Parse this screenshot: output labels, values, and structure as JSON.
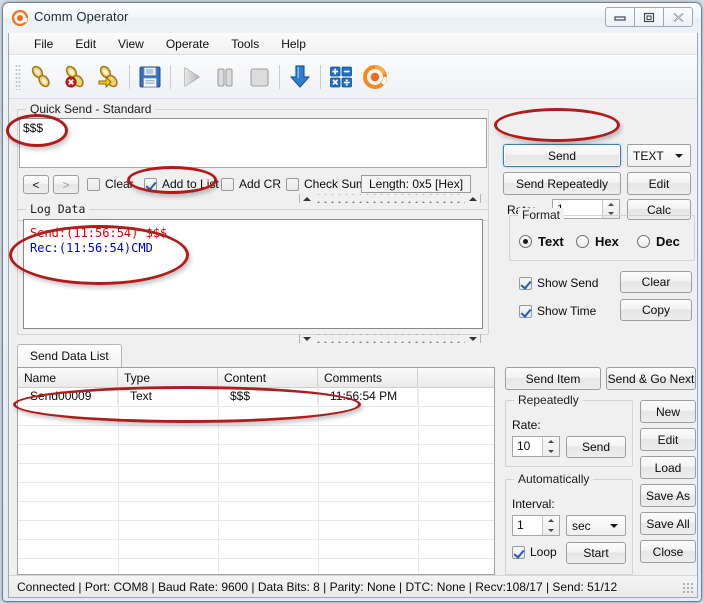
{
  "window": {
    "title": "Comm Operator",
    "app_icon": "comm-operator-logo-icon",
    "controls": {
      "minimize": "minimize-icon",
      "maximize": "maximize-icon",
      "close": "close-icon"
    }
  },
  "menubar": {
    "items": [
      "File",
      "Edit",
      "View",
      "Operate",
      "Tools",
      "Help"
    ]
  },
  "toolbar": {
    "items": [
      {
        "name": "connect-icon",
        "label": "Connect"
      },
      {
        "name": "disconnect-icon",
        "label": "Disconnect"
      },
      {
        "name": "reconnect-icon",
        "label": "Reconnect"
      },
      {
        "name": "save-icon",
        "label": "Save"
      },
      {
        "name": "play-icon",
        "label": "Start"
      },
      {
        "name": "pause-icon",
        "label": "Pause"
      },
      {
        "name": "stop-icon",
        "label": "Stop"
      },
      {
        "name": "download-arrow-icon",
        "label": "Receive"
      },
      {
        "name": "calculator-icon",
        "label": "Calculator"
      },
      {
        "name": "comm-operator-logo-icon",
        "label": "About"
      }
    ]
  },
  "quick_send": {
    "group_title": "Quick Send - Standard",
    "input_value": "$$$",
    "nav_prev": "<",
    "nav_next": ">",
    "checkboxes": [
      {
        "label": "Clear",
        "checked": false
      },
      {
        "label": "Add to List",
        "checked": true
      },
      {
        "label": "Add CR",
        "checked": false
      },
      {
        "label": "Check Sum",
        "checked": false
      }
    ],
    "length_label": "Length: 0x5 [Hex]",
    "send_button": "Send",
    "send_repeatedly_button": "Send Repeatedly",
    "format_combo": "TEXT",
    "edit_button": "Edit",
    "calc_button": "Calc",
    "rate_label": "Rate:",
    "rate_value": "1"
  },
  "log": {
    "group_title": "Log Data",
    "lines": [
      {
        "kind": "send",
        "text": "Send:(11:56:54) $$$"
      },
      {
        "kind": "rec",
        "text": "Rec:(11:56:54)CMD"
      }
    ]
  },
  "format_panel": {
    "group_title": "Format",
    "options": [
      {
        "label": "Text",
        "selected": true
      },
      {
        "label": "Hex",
        "selected": false
      },
      {
        "label": "Dec",
        "selected": false
      }
    ],
    "checkboxes": [
      {
        "label": "Show Send",
        "checked": true
      },
      {
        "label": "Show Time",
        "checked": true
      }
    ],
    "clear_button": "Clear",
    "copy_button": "Copy"
  },
  "send_data_list": {
    "tab_label": "Send Data List",
    "columns": [
      "Name",
      "Type",
      "Content",
      "Comments"
    ],
    "rows": [
      {
        "Name": "Send00009",
        "Type": "Text",
        "Content": "$$$",
        "Comments": "11:56:54 PM"
      }
    ]
  },
  "right_panel": {
    "send_item_button": "Send Item",
    "send_go_next_button": "Send & Go Next",
    "repeatedly": {
      "group_title": "Repeatedly",
      "rate_label": "Rate:",
      "rate_value": "10",
      "send_button": "Send"
    },
    "automatically": {
      "group_title": "Automatically",
      "interval_label": "Interval:",
      "interval_value": "1",
      "unit_value": "sec",
      "loop_label": "Loop",
      "loop_checked": true,
      "start_button": "Start"
    },
    "buttons": [
      "New",
      "Edit",
      "Load",
      "Save As",
      "Save All",
      "Close"
    ]
  },
  "statusbar": {
    "text": "Connected | Port: COM8 | Baud Rate: 9600 | Data Bits: 8 | Parity: None | DTC: None | Recv:108/17 | Send: 51/12"
  },
  "annotations": {
    "color": "#b11b1b",
    "targets": [
      "quick-send-input",
      "add-to-list-checkbox",
      "send-button",
      "log-lines",
      "send-data-list-row"
    ]
  }
}
